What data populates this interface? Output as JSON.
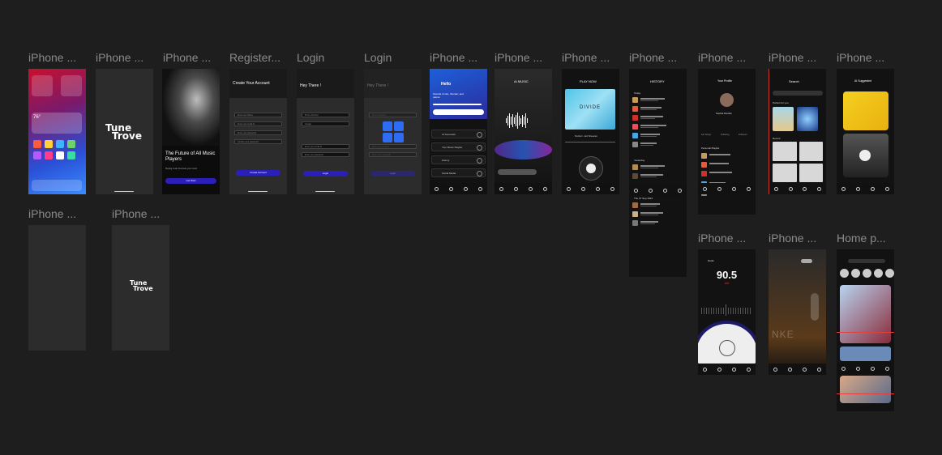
{
  "canvas": {
    "background": "#1e1e1e"
  },
  "frames": {
    "f1": {
      "label": "iPhone ..."
    },
    "f2": {
      "label": "iPhone ..."
    },
    "f3": {
      "label": "iPhone ...",
      "title": "The Future of All Music Players",
      "subtitle": "Playing music that feels your mood",
      "cta": "Get Start"
    },
    "f4": {
      "label": "Register...",
      "title": "Create Your Account",
      "fields": [
        "Enter user Name",
        "Enter your email id",
        "Enter your password",
        "Confirm your password"
      ],
      "cta": "Create Account"
    },
    "f5": {
      "label": "Login",
      "title": "Hey There !",
      "options": [
        "Phone Number",
        "Google"
      ],
      "fields": [
        "Enter your email id",
        "Enter your password"
      ],
      "cta": "Login"
    },
    "f6": {
      "label": "Login",
      "title": "Hey There !",
      "options": [
        "Phone Number"
      ],
      "fields": [
        "Enter your email id",
        "Enter your password"
      ],
      "cta": "Login"
    },
    "f7": {
      "label": "iPhone ...",
      "greeting": "Hello",
      "tagline": "Sounds of rain, thunder, and nature",
      "menu": [
        "AI Generator",
        "Your Music Playlist",
        "History",
        "Social Media"
      ]
    },
    "f8": {
      "label": "iPhone ...",
      "title": "AI MUSIC"
    },
    "f9": {
      "label": "iPhone ...",
      "title": "PLAY NOW",
      "album": "DIVIDE",
      "track": "Perfect - Ed Sheeran"
    },
    "f10": {
      "label": "iPhone ...",
      "title": "HISTORY",
      "sections": [
        "Today",
        "Yesterday",
        "Thu 27 Sep 2024"
      ]
    },
    "f11": {
      "label": "iPhone ...",
      "title": "Your Profile",
      "name": "Sophia Randle",
      "stats": [
        "Fav Songs",
        "Following",
        "Followers"
      ],
      "section": "Personal Playlist"
    },
    "f12": {
      "label": "iPhone ...",
      "title": "Search",
      "section1": "Perfect for you",
      "section2": "Recent"
    },
    "f13": {
      "label": "iPhone ...",
      "title": "AI Suggested"
    },
    "f14": {
      "label": "iPhone ..."
    },
    "f15": {
      "label": "iPhone ..."
    },
    "f16": {
      "label": "iPhone ...",
      "title": "Radio",
      "frequency": "90.5",
      "band": "AM"
    },
    "f17": {
      "label": "iPhone ..."
    },
    "f18": {
      "label": "Home p..."
    }
  },
  "brand": {
    "logo_line1": "Tune",
    "logo_line2": "Trove"
  },
  "colors": {
    "accent": "#2a1fb8",
    "bg": "#1e1e1e",
    "frame": "#2c2c2c"
  }
}
